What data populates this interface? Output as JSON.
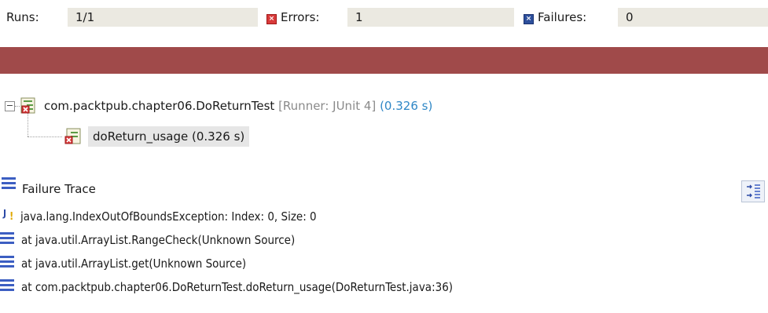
{
  "counters": {
    "runs_label": "Runs:",
    "runs_value": "1/1",
    "errors_label": "Errors:",
    "errors_value": "1",
    "failures_label": "Failures:",
    "failures_value": "0"
  },
  "progress": {
    "state": "error",
    "fraction": 1.0,
    "color": "#a04a4a"
  },
  "tree": {
    "root": {
      "expander": "−",
      "name": "com.packtpub.chapter06.DoReturnTest",
      "runner": "[Runner: JUnit 4]",
      "time": "(0.326 s)",
      "icon": "test-suite-error-icon"
    },
    "child": {
      "label": "doReturn_usage (0.326 s)",
      "icon": "test-error-icon"
    }
  },
  "failure_trace": {
    "title": "Failure Trace",
    "lines": [
      {
        "icon": "exception-icon",
        "text": "java.lang.IndexOutOfBoundsException: Index: 0, Size: 0"
      },
      {
        "icon": "stack-frame-icon",
        "text": "at java.util.ArrayList.RangeCheck(Unknown Source)"
      },
      {
        "icon": "stack-frame-icon",
        "text": "at java.util.ArrayList.get(Unknown Source)"
      },
      {
        "icon": "stack-frame-icon",
        "text": "at com.packtpub.chapter06.DoReturnTest.doReturn_usage(DoReturnTest.java:36)"
      }
    ]
  },
  "colors": {
    "accent_blue": "#3c5ec2",
    "error_red": "#d83a3a",
    "time_blue": "#2f87c6",
    "muted_gray": "#8a8a8a"
  }
}
